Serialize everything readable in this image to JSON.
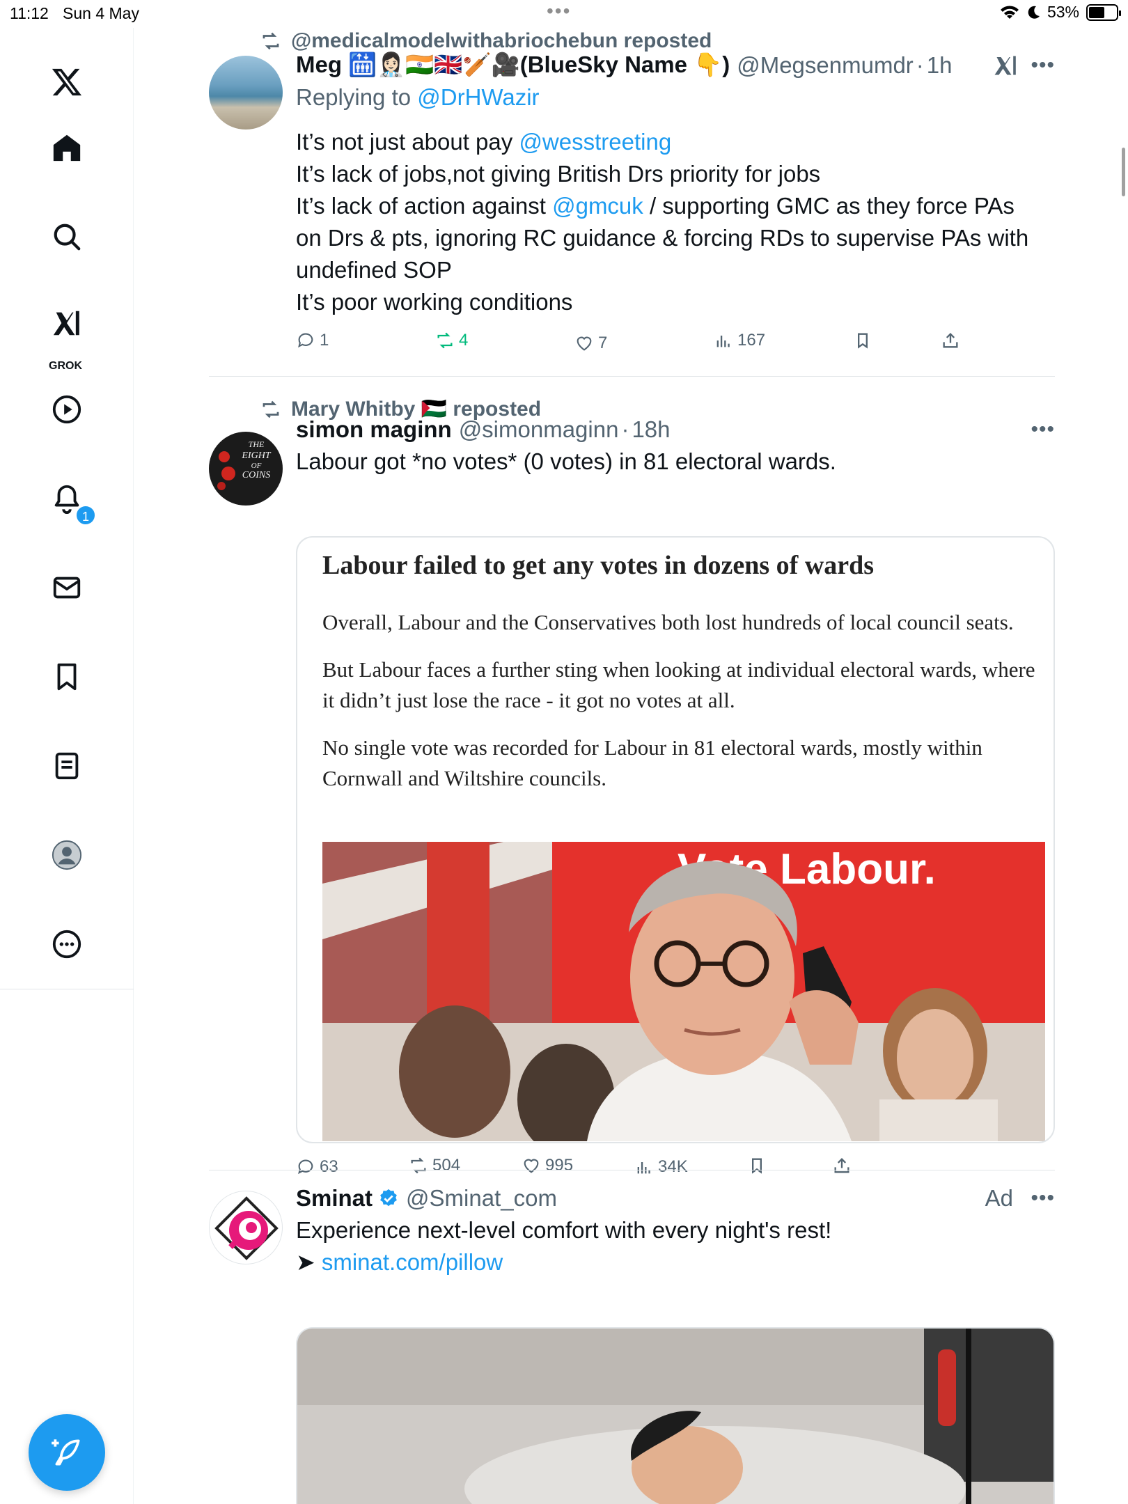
{
  "status_bar": {
    "time": "11:12",
    "date": "Sun 4 May",
    "battery": "53%"
  },
  "sidebar": {
    "items": [
      {
        "name": "x-logo"
      },
      {
        "name": "home"
      },
      {
        "name": "explore"
      },
      {
        "name": "grok",
        "label": "GROK"
      },
      {
        "name": "videos"
      },
      {
        "name": "notifications",
        "badge": "1"
      },
      {
        "name": "messages"
      },
      {
        "name": "bookmarks"
      },
      {
        "name": "lists"
      },
      {
        "name": "profile"
      },
      {
        "name": "more"
      }
    ]
  },
  "tweets": [
    {
      "repost_by": "@medicalmodelwithabriochebun reposted",
      "author_name": "Meg 🛗👩🏻‍⚕️🇮🇳🇬🇧🏏🎥(BlueSky Name 👇)",
      "handle": "@Megsenmumdr",
      "time": "1h",
      "replying_prefix": "Replying to",
      "replying_to": "@DrHWazir",
      "body_lines": [
        {
          "pre": "It’s not just about pay ",
          "link": "@wesstreeting",
          "post": ""
        },
        {
          "pre": "It’s lack of jobs,not giving British Drs priority for jobs",
          "link": "",
          "post": ""
        },
        {
          "pre": "It’s lack of action against ",
          "link": "@gmcuk",
          "post": " / supporting GMC as they force PAs"
        },
        {
          "pre": "on Drs & pts, ignoring RC guidance & forcing RDs to supervise PAs with",
          "link": "",
          "post": ""
        },
        {
          "pre": "undefined SOP",
          "link": "",
          "post": ""
        },
        {
          "pre": "It’s poor working conditions",
          "link": "",
          "post": ""
        }
      ],
      "replies": "1",
      "reposts": "4",
      "likes": "7",
      "views": "167"
    },
    {
      "repost_by": "Mary Whitby 🇵🇸 reposted",
      "author_name": "simon maginn",
      "handle": "@simonmaginn",
      "time": "18h",
      "body": "Labour got *no votes* (0 votes) in 81 electoral wards.",
      "avatar_text": [
        "THE",
        "EIGHT",
        "OF",
        "COINS"
      ],
      "article": {
        "headline": "Labour failed to get any votes in dozens of wards",
        "paragraphs": [
          "Overall, Labour and the Conservatives both lost hundreds of local council seats.",
          "But Labour faces a further sting when looking at individual electoral wards, where it didn’t just lose the race - it got no votes at all.",
          "No single vote was recorded for Labour in 81 electoral wards, mostly within Cornwall and Wiltshire councils."
        ],
        "image_sign": "Vote Labour."
      },
      "replies": "63",
      "reposts": "504",
      "likes": "995",
      "views": "34K"
    },
    {
      "author_name": "Sminat",
      "handle": "@Sminat_com",
      "ad_label": "Ad",
      "body": "Experience next-level comfort with every night's rest!",
      "link_prefix": "➤ ",
      "link": "sminat.com/pillow"
    }
  ],
  "colors": {
    "accent": "#1d9bf0",
    "repost_green": "#00ba7c",
    "muted": "#536471",
    "labour_red": "#e4312c"
  }
}
